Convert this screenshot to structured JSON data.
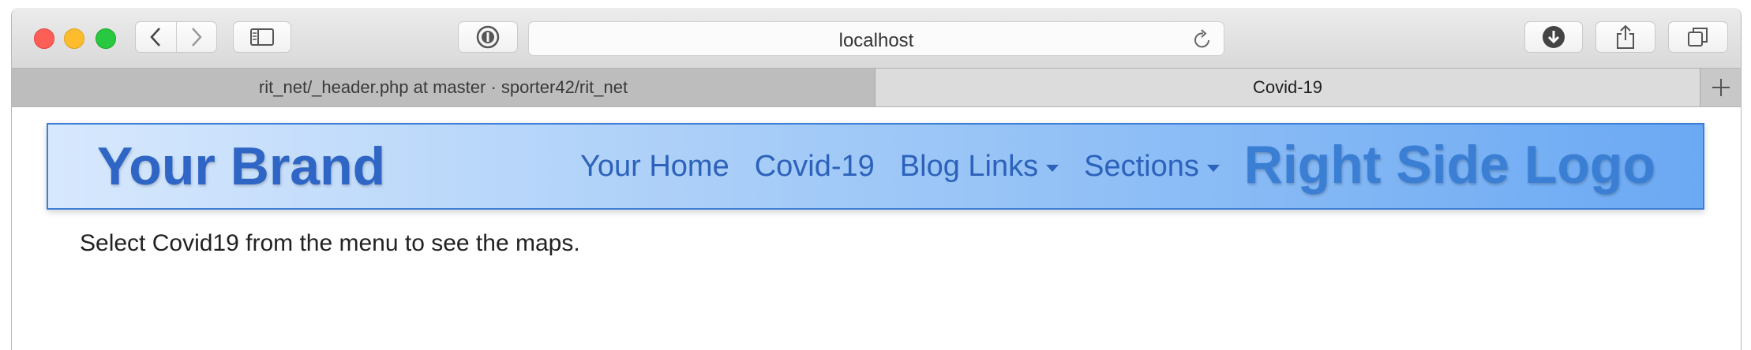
{
  "browser": {
    "url": "localhost",
    "tabs": [
      {
        "title": "rit_net/_header.php at master · sporter42/rit_net"
      },
      {
        "title": "Covid-19"
      }
    ]
  },
  "navbar": {
    "brand": "Your Brand",
    "links": [
      {
        "label": "Your Home"
      },
      {
        "label": "Covid-19"
      },
      {
        "label": "Blog Links"
      },
      {
        "label": "Sections"
      }
    ],
    "right_logo": "Right Side Logo"
  },
  "content": {
    "message": "Select Covid19 from the menu to see the maps."
  },
  "icons": [
    "back-icon",
    "forward-icon",
    "sidebar-icon",
    "password-icon",
    "reload-icon",
    "download-icon",
    "share-icon",
    "tabs-icon",
    "plus-icon",
    "caret-down-icon"
  ],
  "colors": {
    "brand_text": "#2f66c5",
    "nav_link": "#2c62bb",
    "navbar_border": "#3d7fd6",
    "gradient_start": "#d7e8fd",
    "gradient_end": "#6ba9f3"
  }
}
